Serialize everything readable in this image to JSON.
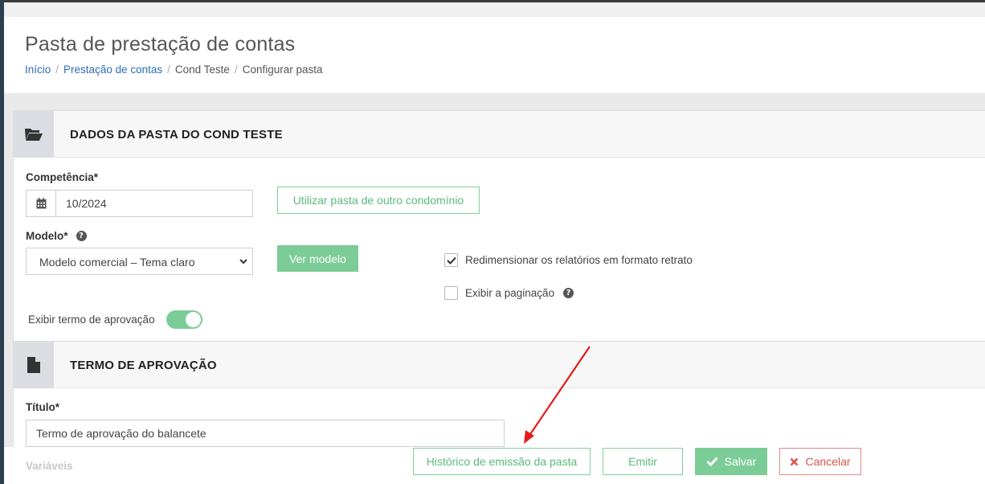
{
  "page": {
    "title": "Pasta de prestação de contas",
    "breadcrumb": [
      "Início",
      "Prestação de contas",
      "Cond Teste",
      "Configurar pasta"
    ]
  },
  "section1": {
    "title": "DADOS DA PASTA DO COND TESTE",
    "icon": "folder-open-icon"
  },
  "form": {
    "competencia_label": "Competência*",
    "competencia_value": "10/2024",
    "other_condo_button": "Utilizar pasta de outro condomínio",
    "modelo_label": "Modelo*",
    "modelo_value": "Modelo comercial – Tema claro",
    "ver_modelo_button": "Ver modelo",
    "resize_label": "Redimensionar os relatórios em formato retrato",
    "resize_checked": true,
    "pagination_label": "Exibir a paginação",
    "pagination_checked": false,
    "approval_toggle_label": "Exibir termo de aprovação",
    "approval_toggle_on": true
  },
  "section2": {
    "title": "TERMO DE APROVAÇÃO",
    "icon": "file-icon",
    "titulo_label": "Título*",
    "titulo_value": "Termo de aprovação do balancete",
    "variaveis_label": "Variáveis"
  },
  "footer": {
    "history_button": "Histórico de emissão da pasta",
    "emit_button": "Emitir",
    "save_button": "Salvar",
    "cancel_button": "Cancelar"
  },
  "colors": {
    "accent_green": "#7ccc98",
    "link_blue": "#2f6fb1",
    "cancel_red": "#d9534f",
    "annotation_arrow": "#e21b1b"
  }
}
